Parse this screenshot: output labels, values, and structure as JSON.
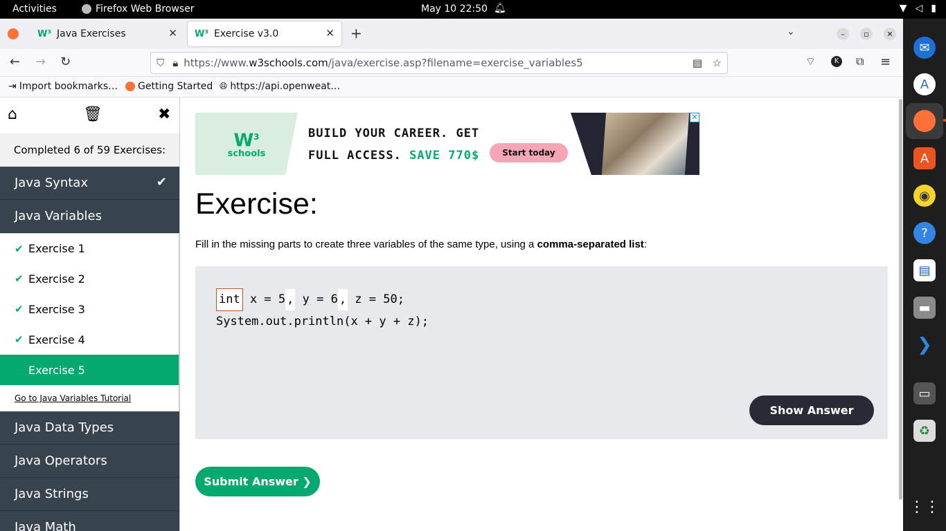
{
  "topbar": {
    "activities": "Activities",
    "app_name": "Firefox Web Browser",
    "clock": "May 10  22:50"
  },
  "browser": {
    "tabs": [
      {
        "label": "Java Exercises",
        "favicon": "w3-icon"
      },
      {
        "label": "Exercise v3.0",
        "favicon": "w3-icon",
        "selected": true
      }
    ],
    "url": {
      "prefix": "https://www.",
      "host": "w3schools.com",
      "path": "/java/exercise.asp?filename=exercise_variables5"
    },
    "bookmarks": [
      "Import bookmarks…",
      "Getting Started",
      "https://api.openweat…"
    ]
  },
  "sidebar": {
    "completed": "Completed 6 of 59 Exercises:",
    "categories_top": [
      "Java Syntax",
      "Java Variables"
    ],
    "exercises": [
      "Exercise 1",
      "Exercise 2",
      "Exercise 3",
      "Exercise 4",
      "Exercise 5"
    ],
    "tutorial_link": "Go to Java Variables Tutorial",
    "categories_bottom": [
      "Java Data Types",
      "Java Operators",
      "Java Strings",
      "Java Math"
    ]
  },
  "ad": {
    "logo_sup": "3",
    "logo_text": "schools",
    "line1": "BUILD YOUR CAREER. GET",
    "line2": "FULL ACCESS.",
    "line2_green": "SAVE 770$",
    "button": "Start today"
  },
  "exercise": {
    "title": "Exercise:",
    "description": "Fill in the missing parts to create three variables of the same type, using a ",
    "description_bold": "comma-separated list",
    "description_end": ":",
    "input_value": "int",
    "code_line1_a": " x = 5",
    "blank": ",",
    "code_line1_b": " y = 6",
    "code_line1_c": " z = 50;",
    "code_line2": "System.out.println(x + y + z);",
    "show_answer": "Show Answer",
    "submit": "Submit Answer ❯"
  }
}
